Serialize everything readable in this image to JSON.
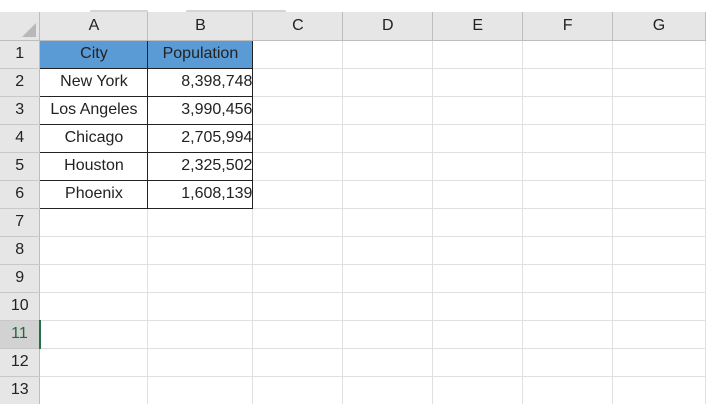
{
  "columns": [
    "A",
    "B",
    "C",
    "D",
    "E",
    "F",
    "G"
  ],
  "rows": [
    "1",
    "2",
    "3",
    "4",
    "5",
    "6",
    "7",
    "8",
    "9",
    "10",
    "11",
    "12",
    "13"
  ],
  "active_row": "11",
  "table": {
    "header": [
      "City",
      "Population"
    ],
    "data": [
      [
        "New York",
        "8,398,748"
      ],
      [
        "Los Angeles",
        "3,990,456"
      ],
      [
        "Chicago",
        "2,705,994"
      ],
      [
        "Houston",
        "2,325,502"
      ],
      [
        "Phoenix",
        "1,608,139"
      ]
    ]
  },
  "colors": {
    "header_fill": "#5b9bd5",
    "active_row_accent": "#217346",
    "grid_line": "#e0e0e0",
    "header_bg": "#e6e6e6"
  }
}
